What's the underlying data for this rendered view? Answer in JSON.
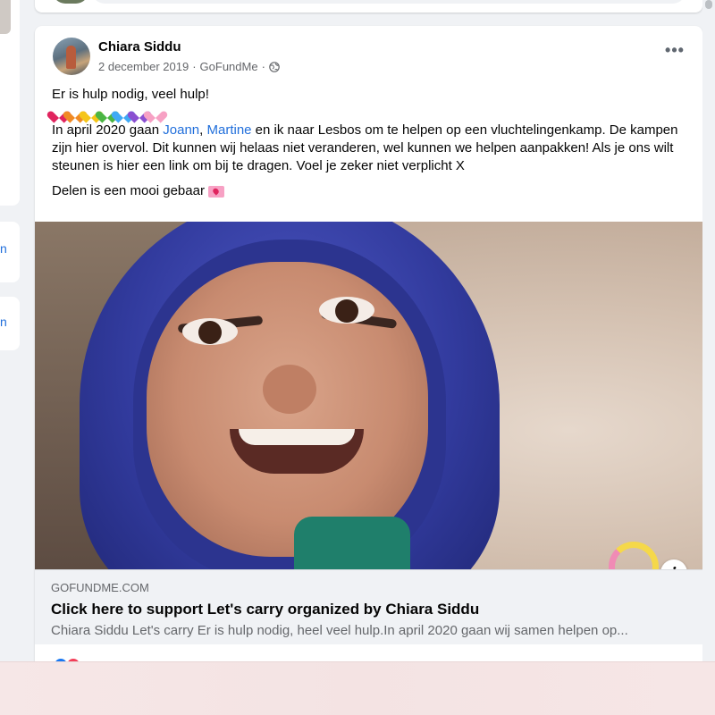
{
  "left_rail": {
    "letters": [
      "n",
      "n"
    ]
  },
  "post": {
    "author": "Chiara Siddu",
    "date": "2 december 2019",
    "separator": "·",
    "source": "GoFundMe",
    "privacy_icon": "globe-icon",
    "more_icon": "•••",
    "text": {
      "line1": "Er is hulp nodig, veel hulp!",
      "hearts": [
        "#e0245e",
        "#f08a24",
        "#f5c518",
        "#4bb543",
        "#3fa9f5",
        "#8a4fd1",
        "#f7a1c4"
      ],
      "para_before_tags": "In april 2020 gaan ",
      "tag1": "Joann",
      "tag_sep": ", ",
      "tag2": "Martine",
      "para_after_tags": " en ik naar Lesbos om te helpen op een vluchtelingenkamp. De kampen zijn hier overvol. Dit kunnen wij helaas niet veranderen, wel kunnen we helpen aanpakken! Als je ons wilt steunen is hier een link om bij te dragen. Voel je zeker niet verplicht X",
      "share_line": "Delen is een mooi gebaar"
    },
    "link_preview": {
      "domain": "GOFUNDME.COM",
      "title": "Click here to support Let's carry organized by Chiara Siddu",
      "description": "Chiara Siddu Let's carry Er is hulp nodig, heel veel hulp.In april 2020 gaan wij samen helpen op...",
      "info_label": "i"
    }
  },
  "colors": {
    "link": "#216fdb",
    "meta": "#65676b",
    "background": "#f0f2f5"
  }
}
